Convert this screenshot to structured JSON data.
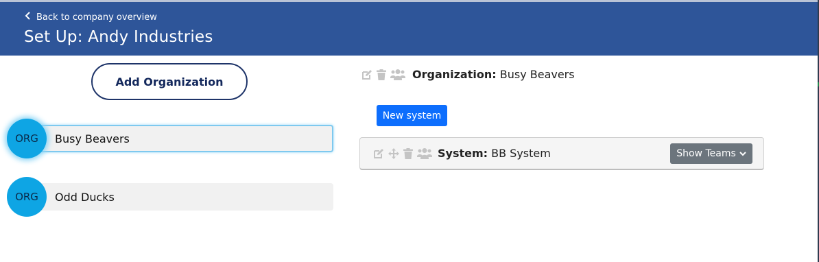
{
  "header": {
    "back_label": "Back to company overview",
    "title": "Set Up: Andy Industries"
  },
  "sidebar": {
    "add_org_label": "Add Organization",
    "orgs": [
      {
        "badge": "ORG",
        "name": "Busy Beavers",
        "active": true
      },
      {
        "badge": "ORG",
        "name": "Odd Ducks",
        "active": false
      }
    ]
  },
  "main": {
    "org_prefix": "Organization:",
    "org_name": "Busy Beavers",
    "new_system_label": "New system",
    "system": {
      "prefix": "System:",
      "name": "BB System",
      "show_teams_label": "Show Teams"
    }
  },
  "icons": {
    "back": "chevron-left-icon",
    "edit": "edit-icon",
    "move": "move-icon",
    "delete": "trash-icon",
    "teams": "users-icon",
    "dropdown": "chevron-down-icon"
  },
  "colors": {
    "header_bg": "#2e5599",
    "org_badge": "#0ea5e4",
    "primary_button": "#0d6efd",
    "secondary_button": "#6c757d",
    "add_org_border": "#1e3469"
  }
}
